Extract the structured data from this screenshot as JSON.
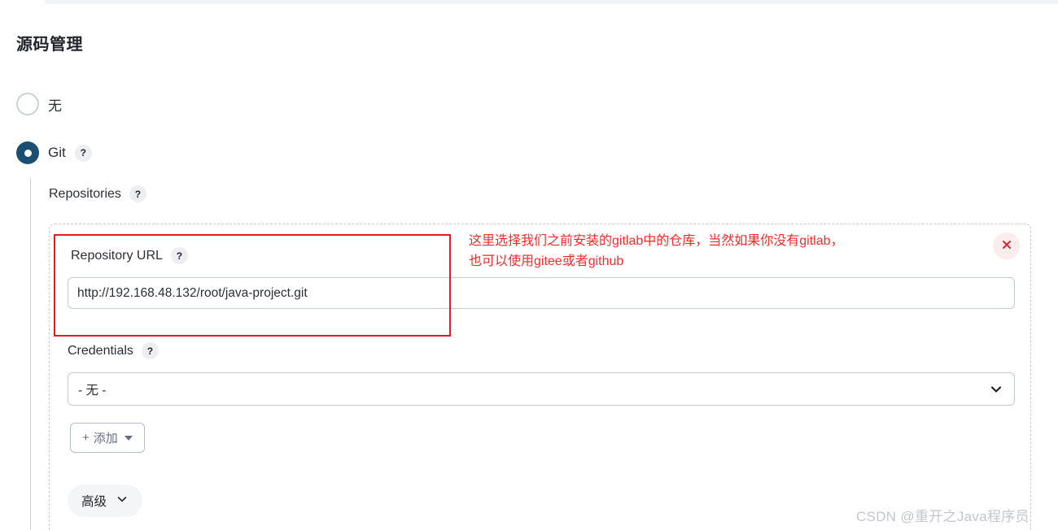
{
  "page": {
    "title": "源码管理",
    "watermark": "CSDN @重开之Java程序员"
  },
  "scm_options": [
    {
      "label": "无",
      "selected": false,
      "has_help": false
    },
    {
      "label": "Git",
      "selected": true,
      "has_help": true,
      "help_label": "?"
    }
  ],
  "repositories": {
    "section_label": "Repositories",
    "help_label": "?",
    "repo_url": {
      "label": "Repository URL",
      "help_label": "?",
      "value": "http://192.168.48.132/root/java-project.git",
      "placeholder": ""
    },
    "credentials": {
      "label": "Credentials",
      "help_label": "?",
      "selected": "- 无 -",
      "options": [
        "- 无 -"
      ]
    },
    "add_button": {
      "plus": "+",
      "label": "添加"
    },
    "advanced_button": {
      "label": "高级"
    },
    "delete_button": {
      "label": "×"
    }
  },
  "annotation": {
    "text": "这里选择我们之前安装的gitlab中的仓库，当然如果你没有gitlab，\n也可以使用gitee或者github",
    "color": "#fa2a2a"
  },
  "colors": {
    "radio_selected": "#1a4f72",
    "annotation_red": "#e8191f",
    "border_gray": "#c4ccd2",
    "delete_bg": "#fdeced"
  }
}
